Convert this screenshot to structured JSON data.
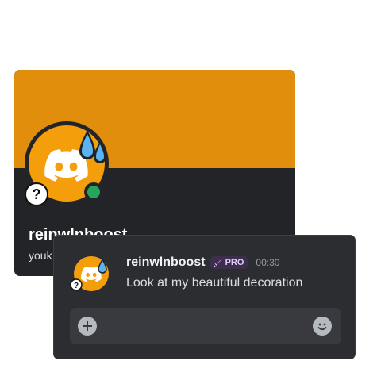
{
  "profile": {
    "banner_color": "#e08e0b",
    "username": "reinwlnboost",
    "pronoun_preview": "youk",
    "status": "online",
    "status_color": "#23a55a",
    "avatar_icon": "discord-logo-icon",
    "avatar_color": "#f59e0b",
    "decoration_icon": "sweat-drop-icon",
    "badge_icon": "question-mark-icon"
  },
  "message": {
    "author": "reinwlnboost",
    "badge_label": "PRO",
    "badge_icon": "sword-icon",
    "timestamp": "00:30",
    "text": "Look at my beautiful decoration"
  },
  "composer": {
    "placeholder": "",
    "attach_icon": "plus-circle-icon",
    "emoji_icon": "smile-icon"
  }
}
